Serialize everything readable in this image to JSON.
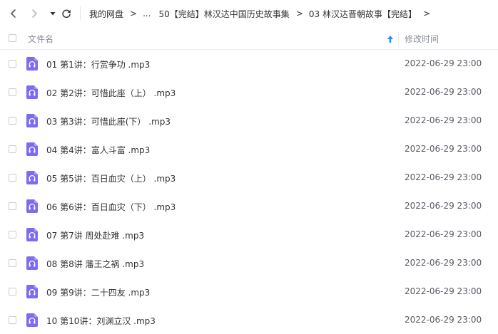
{
  "nav": {
    "back_icon": "chevron-left-icon",
    "forward_icon": "chevron-right-icon",
    "history_icon": "caret-down-icon",
    "refresh_icon": "refresh-icon"
  },
  "breadcrumb": {
    "items": [
      {
        "label": "我的网盘"
      },
      {
        "label": "..."
      },
      {
        "label": "50【完结】林汉达中国历史故事集"
      },
      {
        "label": "03 林汉达晋朝故事【完结】"
      }
    ],
    "separator": ">"
  },
  "list_header": {
    "name_label": "文件名",
    "time_label": "修改时间",
    "sort_icon": "sort-ascending-icon"
  },
  "colors": {
    "accent": "#0d94ff",
    "file_icon": "#7c6cf2",
    "text": "#333333",
    "muted": "#8a8f99"
  },
  "files": [
    {
      "name": "01 第1讲：行赏争功 .mp3",
      "modified": "2022-06-29 23:00",
      "icon": "audio-file-icon"
    },
    {
      "name": "02 第2讲：可惜此座（上） .mp3",
      "modified": "2022-06-29 23:00",
      "icon": "audio-file-icon"
    },
    {
      "name": "03 第3讲：可惜此座(下） .mp3",
      "modified": "2022-06-29 23:00",
      "icon": "audio-file-icon"
    },
    {
      "name": "04 第4讲：富人斗富 .mp3",
      "modified": "2022-06-29 23:00",
      "icon": "audio-file-icon"
    },
    {
      "name": "05 第5讲：百日血灾（上） .mp3",
      "modified": "2022-06-29 23:00",
      "icon": "audio-file-icon"
    },
    {
      "name": "06 第6讲：百日血灾（下） .mp3",
      "modified": "2022-06-29 23:00",
      "icon": "audio-file-icon"
    },
    {
      "name": "07 第7讲 周处赴难 .mp3",
      "modified": "2022-06-29 23:00",
      "icon": "audio-file-icon"
    },
    {
      "name": "08 第8讲 藩王之祸 .mp3",
      "modified": "2022-06-29 23:00",
      "icon": "audio-file-icon"
    },
    {
      "name": "09 第9讲：二十四友 .mp3",
      "modified": "2022-06-29 23:00",
      "icon": "audio-file-icon"
    },
    {
      "name": "10 第10讲：刘渊立汉 .mp3",
      "modified": "2022-06-29 23:00",
      "icon": "audio-file-icon"
    }
  ]
}
